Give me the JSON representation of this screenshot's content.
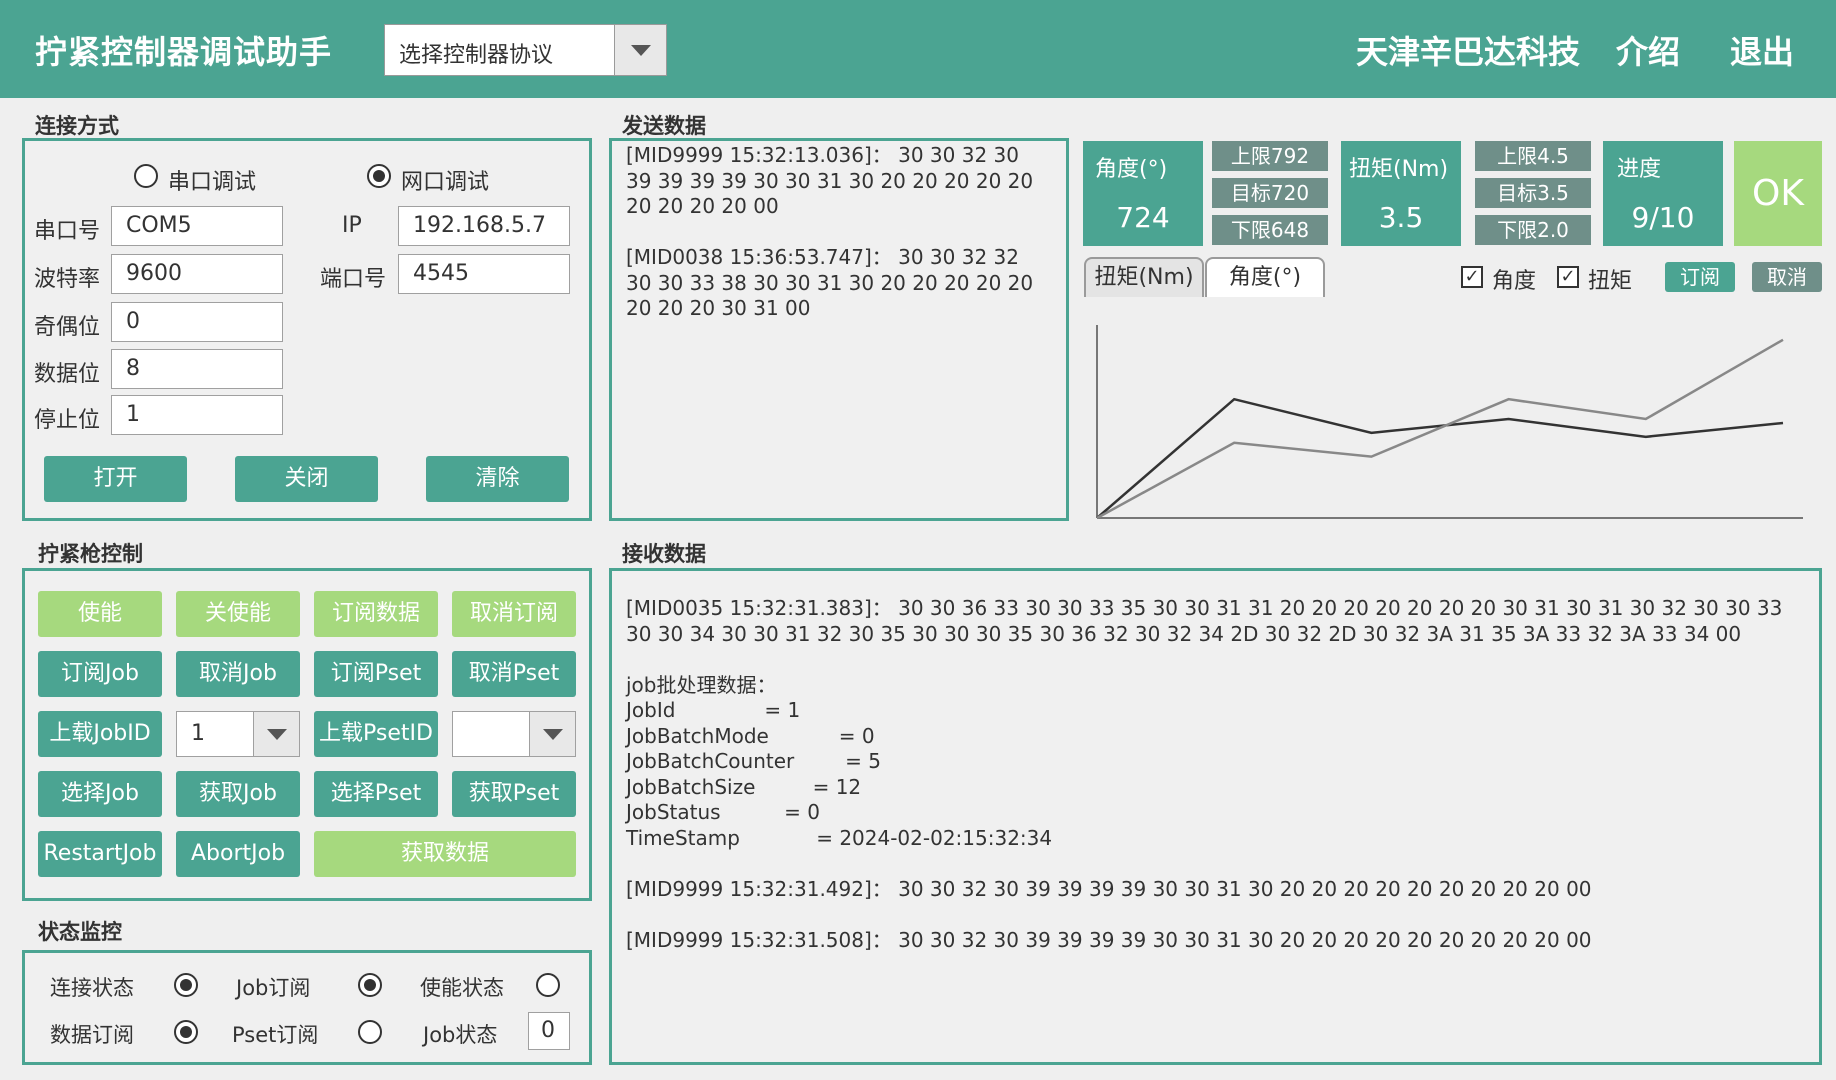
{
  "header": {
    "title": "拧紧控制器调试助手",
    "protocol_select": "选择控制器协议",
    "company": "天津辛巴达科技",
    "intro": "介绍",
    "exit": "退出"
  },
  "connection": {
    "title": "连接方式",
    "serial_mode": "串口调试",
    "network_mode": "网口调试",
    "selected_mode": "network",
    "fields": [
      {
        "label": "串口号",
        "value": "COM5"
      },
      {
        "label": "波特率",
        "value": "9600"
      },
      {
        "label": "奇偶位",
        "value": "0"
      },
      {
        "label": "数据位",
        "value": "8"
      },
      {
        "label": "停止位",
        "value": "1"
      }
    ],
    "ip_label": "IP",
    "ip_value": "192.168.5.7",
    "port_label": "端口号",
    "port_value": "4545",
    "open": "打开",
    "close": "关闭",
    "clear": "清除"
  },
  "send": {
    "title": "发送数据",
    "text": "[MID9999 15:32:13.036]： 30 30 32 30 39 39 39 39 30 30 31 30 20 20 20 20 20 20 20 20 20 00\n\n[MID0038 15:36:53.747]： 30 30 32 32 30 30 33 38 30 30 31 30 20 20 20 20 20 20 20 20 30 31 00"
  },
  "gun": {
    "title": "拧紧枪控制",
    "row1": [
      "使能",
      "关使能",
      "订阅数据",
      "取消订阅"
    ],
    "row2": [
      "订阅Job",
      "取消Job",
      "订阅Pset",
      "取消Pset"
    ],
    "upload_job": "上载JobID",
    "job_combo": "1",
    "upload_pset": "上载PsetID",
    "pset_combo": "",
    "row4": [
      "选择Job",
      "获取Job",
      "选择Pset",
      "获取Pset"
    ],
    "restart": "RestartJob",
    "abort": "AbortJob",
    "get_data": "获取数据"
  },
  "status": {
    "title": "状态监控",
    "items": [
      {
        "label": "连接状态",
        "on": true
      },
      {
        "label": "Job订阅",
        "on": true
      },
      {
        "label": "使能状态",
        "on": false
      },
      {
        "label": "数据订阅",
        "on": true
      },
      {
        "label": "Pset订阅",
        "on": false
      },
      {
        "label": "Job状态",
        "value": "0"
      }
    ]
  },
  "tiles": {
    "angle_label": "角度(°)",
    "angle_value": "724",
    "angle_upper": "上限792",
    "angle_target": "目标720",
    "angle_lower": "下限648",
    "torque_label": "扭矩(Nm)",
    "torque_value": "3.5",
    "torque_upper": "上限4.5",
    "torque_target": "目标3.5",
    "torque_lower": "下限2.0",
    "progress_label": "进度",
    "progress_value": "9/10",
    "result": "OK",
    "result_color": "#a6d97e"
  },
  "chart_controls": {
    "tab_torque": "扭矩(Nm)",
    "tab_angle": "角度(°)",
    "active_tab": "angle",
    "chk_angle": "角度",
    "chk_torque": "扭矩",
    "subscribe": "订阅",
    "cancel": "取消"
  },
  "chart_data": {
    "type": "line",
    "title": "",
    "xlabel": "",
    "ylabel": "",
    "x": [
      0,
      1,
      2,
      3,
      4,
      5
    ],
    "ylim": [
      0,
      1
    ],
    "grid": false,
    "series": [
      {
        "values": [
          0,
          0.6,
          0.43,
          0.5,
          0.41,
          0.48
        ],
        "color": "#333333"
      },
      {
        "values": [
          0,
          0.38,
          0.31,
          0.6,
          0.5,
          0.9
        ],
        "color": "#888888"
      }
    ]
  },
  "receive": {
    "title": "接收数据",
    "text": "[MID0035 15:32:31.383]： 30 30 36 33 30 30 33 35 30 30 31 31 20 20 20 20 20 20 20 30 31 30 31 30 32 30 30 33 30 30 34 30 30 31 32 30 35 30 30 30 35 30 36 32 30 32 34 2D 30 32 2D 30 32 3A 31 35 3A 33 32 3A 33 34 00\n\njob批处理数据：\nJobId              = 1\nJobBatchMode           = 0\nJobBatchCounter        = 5\nJobBatchSize         = 12\nJobStatus          = 0\nTimeStamp            = 2024-02-02:15:32:34\n\n[MID9999 15:32:31.492]： 30 30 32 30 39 39 39 39 30 30 31 30 20 20 20 20 20 20 20 20 20 00\n\n[MID9999 15:32:31.508]： 30 30 32 30 39 39 39 39 30 30 31 30 20 20 20 20 20 20 20 20 20 00"
  }
}
